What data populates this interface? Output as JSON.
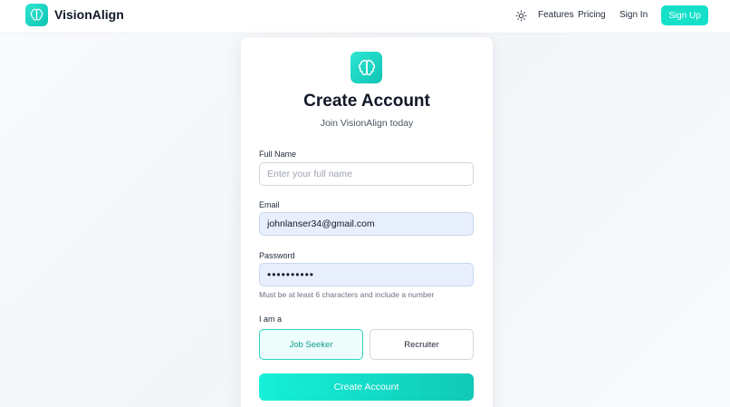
{
  "header": {
    "brand": "VisionAlign",
    "nav": {
      "features": "Features",
      "pricing": "Pricing",
      "sign_in": "Sign In",
      "sign_up": "Sign Up"
    },
    "theme_icon": "sun-icon",
    "logo_icon": "brain-icon"
  },
  "card": {
    "logo_icon": "brain-icon",
    "title": "Create Account",
    "subtitle": "Join VisionAlign today",
    "full_name": {
      "label": "Full Name",
      "placeholder": "Enter your full name",
      "value": ""
    },
    "email": {
      "label": "Email",
      "value": "johnlanser34@gmail.com"
    },
    "password": {
      "label": "Password",
      "value": "••••••••••",
      "hint": "Must be at least 6 characters and include a number"
    },
    "role": {
      "label": "I am a",
      "options": [
        "Job Seeker",
        "Recruiter"
      ],
      "selected": "Job Seeker"
    },
    "submit_label": "Create Account"
  },
  "colors": {
    "accent": "#14e0c8",
    "accent_dark": "#0fc3b2",
    "selected_role_text": "#0f9e8d",
    "filled_input_bg": "#e8effc"
  }
}
